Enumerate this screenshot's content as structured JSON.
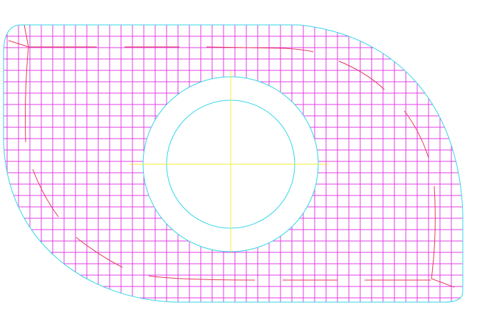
{
  "drawing": {
    "colors": {
      "background": "#ffffff",
      "outline": "#33d6e8",
      "grid": "#e23ce6",
      "hatch_seams": "#e8365a",
      "centerlines": "#f2ee3a"
    }
  }
}
